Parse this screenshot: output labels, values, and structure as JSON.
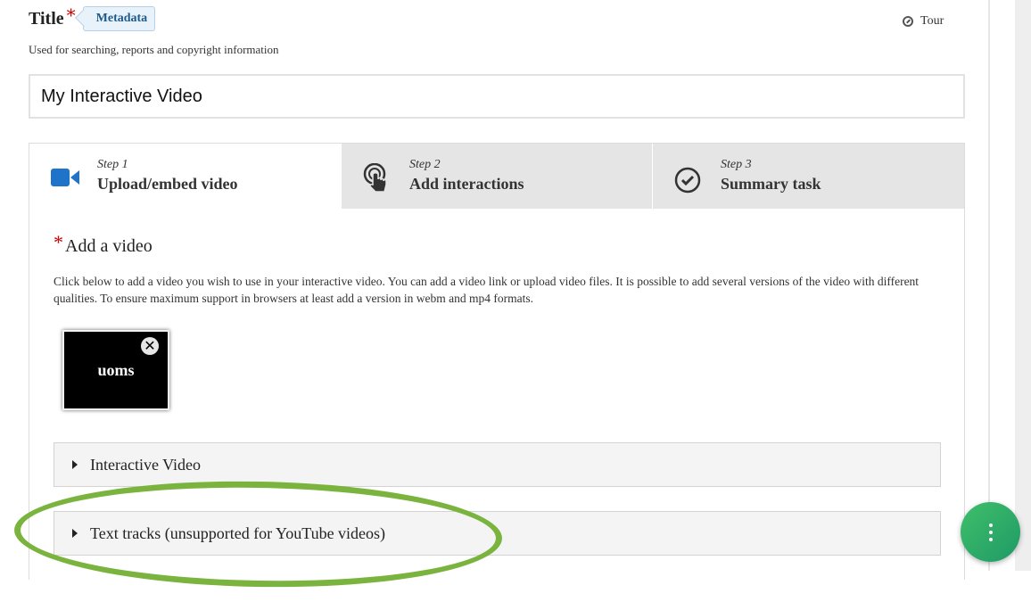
{
  "title_field": {
    "label": "Title",
    "required_mark": "*",
    "metadata_button": "Metadata",
    "description": "Used for searching, reports and copyright information",
    "value": "My Interactive Video"
  },
  "tour": {
    "label": "Tour",
    "icon": "compass-icon"
  },
  "tabs": [
    {
      "step": "Step 1",
      "label": "Upload/embed video",
      "icon": "video-camera-icon",
      "active": true
    },
    {
      "step": "Step 2",
      "label": "Add interactions",
      "icon": "tap-pointer-icon",
      "active": false
    },
    {
      "step": "Step 3",
      "label": "Summary task",
      "icon": "check-circle-icon",
      "active": false
    }
  ],
  "add_video": {
    "required_mark": "*",
    "label": "Add a video",
    "help": "Click below to add a video you wish to use in your interactive video. You can add a video link or upload video files. It is possible to add several versions of the video with different qualities. To ensure maximum support in browsers at least add a version in webm and mp4 formats.",
    "thumbnail_text": "uoms",
    "remove_symbol": "✕"
  },
  "sections": [
    {
      "label": "Interactive Video"
    },
    {
      "label": "Text tracks (unsupported for YouTube videos)"
    }
  ],
  "colors": {
    "accent_blue": "#1f5a8a",
    "highlight_green": "#7ab33e",
    "fab_green": "#2aa866",
    "required_red": "#cc0000"
  }
}
